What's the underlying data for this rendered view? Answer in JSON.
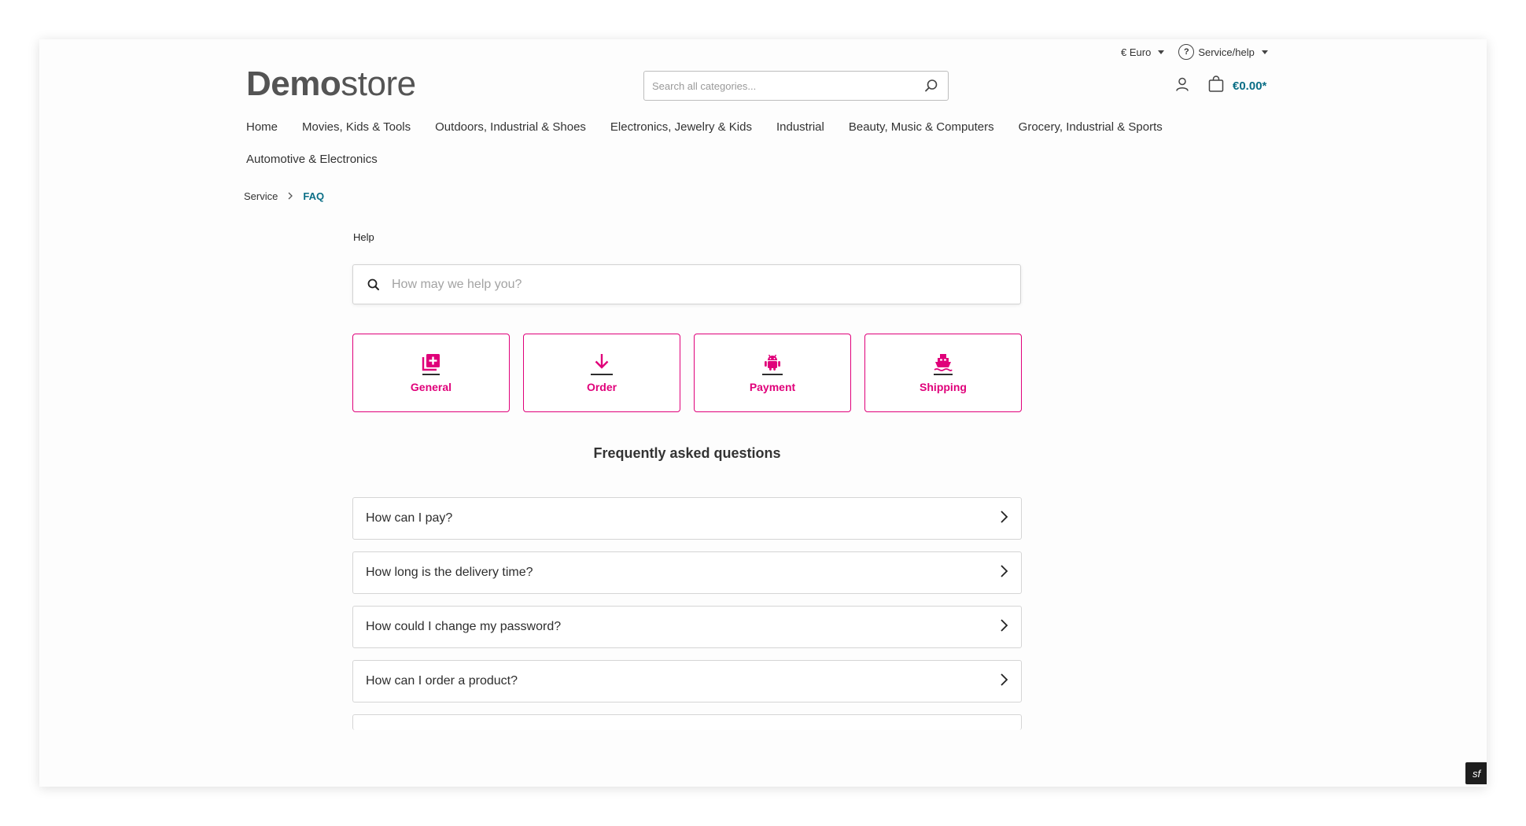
{
  "topbar": {
    "currency_label": "€ Euro",
    "service_label": "Service/help",
    "help_glyph": "?"
  },
  "header": {
    "logo_bold": "Demo",
    "logo_light": "store",
    "search_placeholder": "Search all categories...",
    "cart_total": "€0.00*"
  },
  "nav": {
    "items": [
      {
        "label": "Home"
      },
      {
        "label": "Movies, Kids & Tools"
      },
      {
        "label": "Outdoors, Industrial & Shoes"
      },
      {
        "label": "Electronics, Jewelry & Kids"
      },
      {
        "label": "Industrial"
      },
      {
        "label": "Beauty, Music & Computers"
      },
      {
        "label": "Grocery, Industrial & Sports"
      },
      {
        "label": "Automotive & Electronics"
      }
    ]
  },
  "breadcrumb": {
    "parent": "Service",
    "current": "FAQ"
  },
  "help": {
    "label": "Help",
    "search_placeholder": "How may we help you?"
  },
  "categories": [
    {
      "label": "General",
      "icon": "add-box-icon"
    },
    {
      "label": "Order",
      "icon": "download-icon"
    },
    {
      "label": "Payment",
      "icon": "android-icon"
    },
    {
      "label": "Shipping",
      "icon": "ship-icon"
    }
  ],
  "faq": {
    "title": "Frequently asked questions",
    "questions": [
      {
        "q": "How can I pay?"
      },
      {
        "q": "How long is the delivery time?"
      },
      {
        "q": "How could I change my password?"
      },
      {
        "q": "How can I order a product?"
      }
    ]
  },
  "colors": {
    "accent": "#e0007a",
    "brand_teal": "#0a6e86"
  },
  "debug_toolbar": {
    "glyph": "sf"
  }
}
